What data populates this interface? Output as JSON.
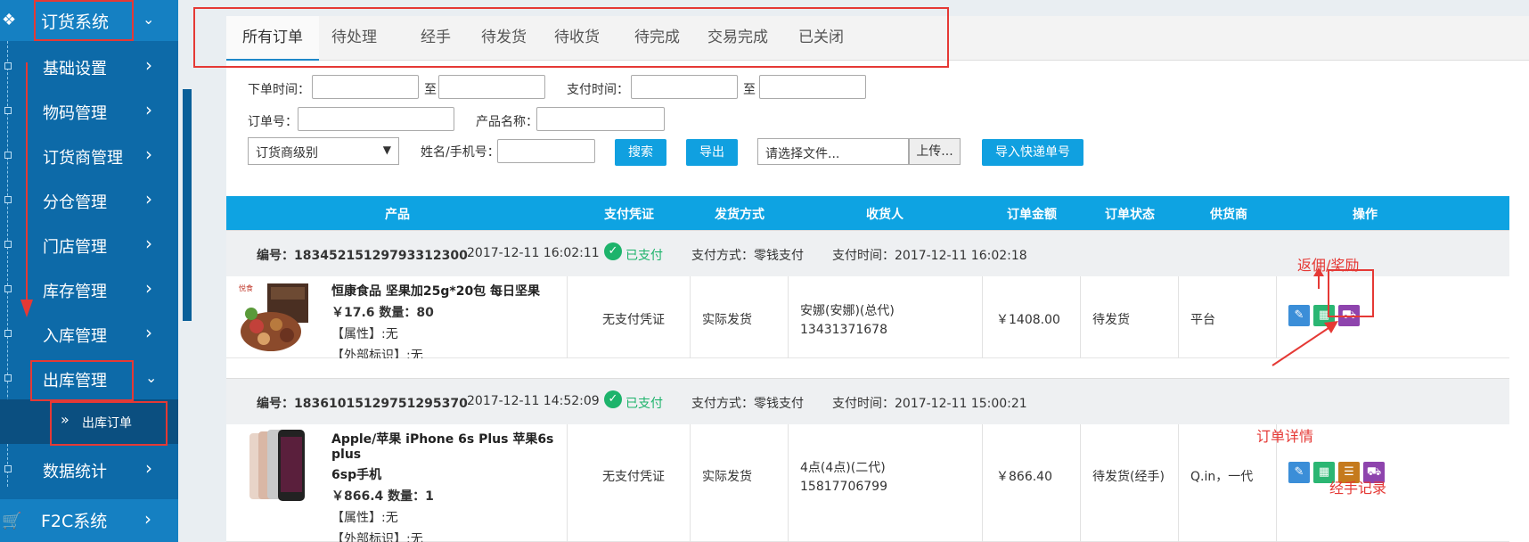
{
  "sidebar": {
    "top": {
      "label": "订货系统",
      "icon": "cubes-icon"
    },
    "items": [
      {
        "label": "基础设置"
      },
      {
        "label": "物码管理"
      },
      {
        "label": "订货商管理"
      },
      {
        "label": "分仓管理"
      },
      {
        "label": "门店管理"
      },
      {
        "label": "库存管理"
      },
      {
        "label": "入库管理"
      },
      {
        "label": "出库管理"
      }
    ],
    "sub_item": {
      "label": "出库订单"
    },
    "after_item": {
      "label": "数据统计"
    },
    "bottom": {
      "label": "F2C系统",
      "icon": "cart-icon"
    }
  },
  "tabs": [
    "所有订单",
    "待处理",
    "经手",
    "待发货",
    "待收货",
    "待完成",
    "交易完成",
    "已关闭"
  ],
  "filters": {
    "order_time_label": "下单时间：",
    "to_label": "至",
    "pay_time_label": "支付时间：",
    "order_no_label": "订单号：",
    "product_name_label": "产品名称：",
    "level_select": "订货商级别",
    "name_phone_label": "姓名/手机号：",
    "search_button": "搜索",
    "export_button": "导出",
    "file_placeholder": "请选择文件...",
    "upload_button": "上传...",
    "import_button": "导入快递单号"
  },
  "table": {
    "headers": [
      "产品",
      "支付凭证",
      "发货方式",
      "收货人",
      "订单金额",
      "订单状态",
      "供货商",
      "操作"
    ]
  },
  "orders": [
    {
      "order_no": "编号：18345215129793312300",
      "order_time": "2017-12-11 16:02:11",
      "paid": "已支付",
      "pay_method": "支付方式：零钱支付",
      "pay_time": "支付时间：2017-12-11 16:02:18",
      "product_name": "恒康食品 坚果加25g*20包 每日坚果",
      "price_qty": "￥17.6 数量：80",
      "attr": "【属性】:无",
      "ext": "【外部标识】:无",
      "voucher": "无支付凭证",
      "ship": "实际发货",
      "receiver": "安娜(安娜)(总代)",
      "phone": "13431371678",
      "amount": "￥1408.00",
      "status": "待发货",
      "supplier": "平台"
    },
    {
      "order_no": "编号：18361015129751295370",
      "order_time": "2017-12-11 14:52:09",
      "paid": "已支付",
      "pay_method": "支付方式：零钱支付",
      "pay_time": "支付时间：2017-12-11 15:00:21",
      "product_name_1": "Apple/苹果 iPhone 6s Plus 苹果6s plus",
      "product_name_2": "6sp手机",
      "price_qty": "￥866.4 数量：1",
      "attr": "【属性】:无",
      "ext": "【外部标识】:无",
      "voucher": "无支付凭证",
      "ship": "实际发货",
      "receiver": "4点(4点)(二代)",
      "phone": "15817706799",
      "amount": "￥866.40",
      "status": "待发货(经手)",
      "supplier": "Q.in，一代"
    }
  ],
  "annotations": {
    "rebate": "返佣/奖励",
    "order_detail": "订单详情",
    "handler_record": "经手记录"
  },
  "colors": {
    "sidebar": "#0d6aa8",
    "accent": "#0ea3e2",
    "paid": "#1db36b",
    "annotation": "#e53935"
  }
}
